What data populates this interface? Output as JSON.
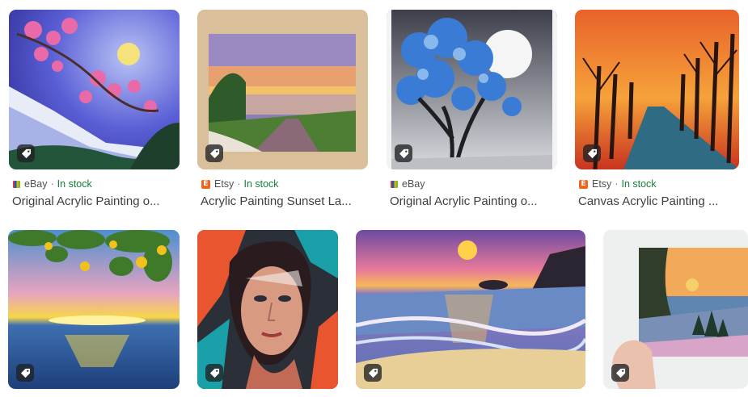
{
  "results": [
    {
      "source": "eBay",
      "stock": "",
      "title": "Original Acrylic Painting o...",
      "favicon": "ebay-icon"
    },
    {
      "source": "Etsy",
      "stock": "In stock",
      "title": "Acrylic Painting Sunset La...",
      "favicon": "etsy-icon"
    },
    {
      "source": "eBay",
      "stock": "",
      "title": "Original Acrylic Painting o...",
      "favicon": "ebay-icon"
    },
    {
      "source": "Etsy",
      "stock": "In stock",
      "title": "Canvas Acrylic Painting ...",
      "favicon": "etsy-icon"
    }
  ],
  "first_card_stock": "In stock",
  "etsy_letter": "E",
  "separator": "·",
  "colors": {
    "in_stock": "#188038",
    "etsy": "#f1641e",
    "title_text": "#3c4043",
    "meta_text": "#4d5156"
  }
}
